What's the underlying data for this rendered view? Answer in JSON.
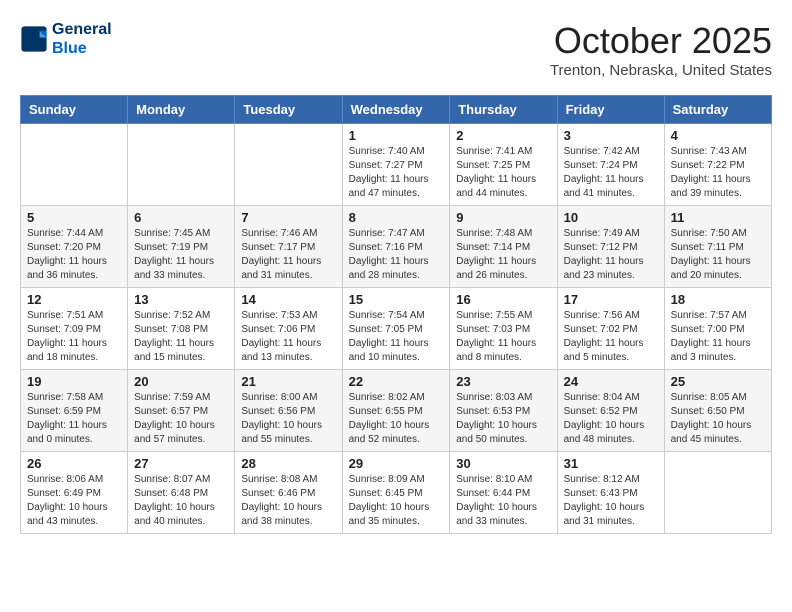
{
  "header": {
    "logo_line1": "General",
    "logo_line2": "Blue",
    "month": "October 2025",
    "location": "Trenton, Nebraska, United States"
  },
  "days_of_week": [
    "Sunday",
    "Monday",
    "Tuesday",
    "Wednesday",
    "Thursday",
    "Friday",
    "Saturday"
  ],
  "weeks": [
    [
      {
        "day": "",
        "info": ""
      },
      {
        "day": "",
        "info": ""
      },
      {
        "day": "",
        "info": ""
      },
      {
        "day": "1",
        "info": "Sunrise: 7:40 AM\nSunset: 7:27 PM\nDaylight: 11 hours and 47 minutes."
      },
      {
        "day": "2",
        "info": "Sunrise: 7:41 AM\nSunset: 7:25 PM\nDaylight: 11 hours and 44 minutes."
      },
      {
        "day": "3",
        "info": "Sunrise: 7:42 AM\nSunset: 7:24 PM\nDaylight: 11 hours and 41 minutes."
      },
      {
        "day": "4",
        "info": "Sunrise: 7:43 AM\nSunset: 7:22 PM\nDaylight: 11 hours and 39 minutes."
      }
    ],
    [
      {
        "day": "5",
        "info": "Sunrise: 7:44 AM\nSunset: 7:20 PM\nDaylight: 11 hours and 36 minutes."
      },
      {
        "day": "6",
        "info": "Sunrise: 7:45 AM\nSunset: 7:19 PM\nDaylight: 11 hours and 33 minutes."
      },
      {
        "day": "7",
        "info": "Sunrise: 7:46 AM\nSunset: 7:17 PM\nDaylight: 11 hours and 31 minutes."
      },
      {
        "day": "8",
        "info": "Sunrise: 7:47 AM\nSunset: 7:16 PM\nDaylight: 11 hours and 28 minutes."
      },
      {
        "day": "9",
        "info": "Sunrise: 7:48 AM\nSunset: 7:14 PM\nDaylight: 11 hours and 26 minutes."
      },
      {
        "day": "10",
        "info": "Sunrise: 7:49 AM\nSunset: 7:12 PM\nDaylight: 11 hours and 23 minutes."
      },
      {
        "day": "11",
        "info": "Sunrise: 7:50 AM\nSunset: 7:11 PM\nDaylight: 11 hours and 20 minutes."
      }
    ],
    [
      {
        "day": "12",
        "info": "Sunrise: 7:51 AM\nSunset: 7:09 PM\nDaylight: 11 hours and 18 minutes."
      },
      {
        "day": "13",
        "info": "Sunrise: 7:52 AM\nSunset: 7:08 PM\nDaylight: 11 hours and 15 minutes."
      },
      {
        "day": "14",
        "info": "Sunrise: 7:53 AM\nSunset: 7:06 PM\nDaylight: 11 hours and 13 minutes."
      },
      {
        "day": "15",
        "info": "Sunrise: 7:54 AM\nSunset: 7:05 PM\nDaylight: 11 hours and 10 minutes."
      },
      {
        "day": "16",
        "info": "Sunrise: 7:55 AM\nSunset: 7:03 PM\nDaylight: 11 hours and 8 minutes."
      },
      {
        "day": "17",
        "info": "Sunrise: 7:56 AM\nSunset: 7:02 PM\nDaylight: 11 hours and 5 minutes."
      },
      {
        "day": "18",
        "info": "Sunrise: 7:57 AM\nSunset: 7:00 PM\nDaylight: 11 hours and 3 minutes."
      }
    ],
    [
      {
        "day": "19",
        "info": "Sunrise: 7:58 AM\nSunset: 6:59 PM\nDaylight: 11 hours and 0 minutes."
      },
      {
        "day": "20",
        "info": "Sunrise: 7:59 AM\nSunset: 6:57 PM\nDaylight: 10 hours and 57 minutes."
      },
      {
        "day": "21",
        "info": "Sunrise: 8:00 AM\nSunset: 6:56 PM\nDaylight: 10 hours and 55 minutes."
      },
      {
        "day": "22",
        "info": "Sunrise: 8:02 AM\nSunset: 6:55 PM\nDaylight: 10 hours and 52 minutes."
      },
      {
        "day": "23",
        "info": "Sunrise: 8:03 AM\nSunset: 6:53 PM\nDaylight: 10 hours and 50 minutes."
      },
      {
        "day": "24",
        "info": "Sunrise: 8:04 AM\nSunset: 6:52 PM\nDaylight: 10 hours and 48 minutes."
      },
      {
        "day": "25",
        "info": "Sunrise: 8:05 AM\nSunset: 6:50 PM\nDaylight: 10 hours and 45 minutes."
      }
    ],
    [
      {
        "day": "26",
        "info": "Sunrise: 8:06 AM\nSunset: 6:49 PM\nDaylight: 10 hours and 43 minutes."
      },
      {
        "day": "27",
        "info": "Sunrise: 8:07 AM\nSunset: 6:48 PM\nDaylight: 10 hours and 40 minutes."
      },
      {
        "day": "28",
        "info": "Sunrise: 8:08 AM\nSunset: 6:46 PM\nDaylight: 10 hours and 38 minutes."
      },
      {
        "day": "29",
        "info": "Sunrise: 8:09 AM\nSunset: 6:45 PM\nDaylight: 10 hours and 35 minutes."
      },
      {
        "day": "30",
        "info": "Sunrise: 8:10 AM\nSunset: 6:44 PM\nDaylight: 10 hours and 33 minutes."
      },
      {
        "day": "31",
        "info": "Sunrise: 8:12 AM\nSunset: 6:43 PM\nDaylight: 10 hours and 31 minutes."
      },
      {
        "day": "",
        "info": ""
      }
    ]
  ]
}
